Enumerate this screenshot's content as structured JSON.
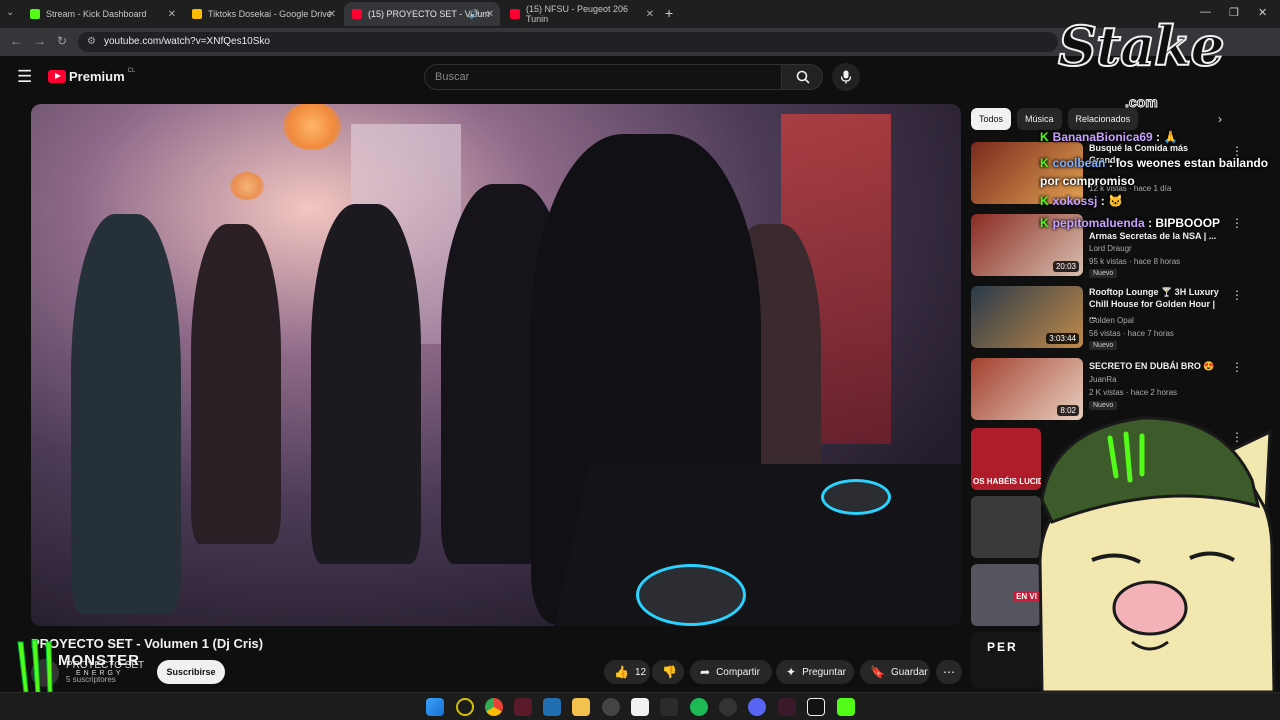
{
  "browser": {
    "tabs": [
      {
        "label": "Stream - Kick Dashboard",
        "favicon_color": "#53fc18"
      },
      {
        "label": "Tiktoks Dosekai - Google Drive",
        "favicon_color": "#fbbc04"
      },
      {
        "label": "(15) PROYECTO SET - Volum",
        "favicon_color": "#ff0033"
      },
      {
        "label": "(15) NFSU - Peugeot 206 Tunin",
        "favicon_color": "#ff0033"
      }
    ],
    "url": "youtube.com/watch?v=XNfQes10Sko"
  },
  "youtube": {
    "logo_text": "Premium",
    "logo_region": "CL",
    "search_placeholder": "Buscar",
    "video": {
      "title": "PROYECTO SET - Volumen 1 (Dj Cris)",
      "channel": "PROYECTO SET",
      "subscribers": "5 suscriptores",
      "subscribe_label": "Suscribirse",
      "likes": "12",
      "share_label": "Compartir",
      "ask_label": "Preguntar",
      "save_label": "Guardar"
    },
    "chips": [
      "Todos",
      "Música",
      "Relacionados"
    ],
    "recommendations": [
      {
        "title": "Busqué la Comida más Grande",
        "channel": "",
        "meta": "12 k vistas · hace 1 día",
        "duration": "",
        "badge": "",
        "thumb_color": "#7a2a1e"
      },
      {
        "title": "Armas Secretas de la NSA | ...",
        "channel": "Lord Draugr",
        "meta": "95 k vistas · hace 8 horas",
        "duration": "20:03",
        "badge": "Nuevo",
        "thumb_color": "#8a2b22"
      },
      {
        "title": "Rooftop Lounge 🍸 3H Luxury Chill House for Golden Hour | ...",
        "channel": "Golden Opal",
        "meta": "56 vistas · hace 7 horas",
        "duration": "3:03:44",
        "badge": "Nuevo",
        "thumb_color": "#6b4a2a"
      },
      {
        "title": "SECRETO EN DUBÁI BRO 😍",
        "channel": "JuanRa",
        "meta": "2 K vistas · hace 2 horas",
        "duration": "8:02",
        "badge": "Nuevo",
        "thumb_color": "#a3402e"
      }
    ],
    "side_thumbs": [
      {
        "text": "OS HABÉIS LUCIDO",
        "color": "#b01d2a"
      },
      {
        "text": "",
        "color": "#3a3a3a"
      },
      {
        "text": "EN VI",
        "color": "#555560"
      },
      {
        "text": "PER",
        "color": "#151515"
      }
    ]
  },
  "chat": [
    {
      "user": "BananaBionica69",
      "message": "🙏"
    },
    {
      "user": "coolbean",
      "message": "los weones estan bailando por compromiso"
    },
    {
      "user": "xokossj",
      "message": "🐱"
    },
    {
      "user": "pepitomaluenda",
      "message": "BIPBOOOP"
    }
  ],
  "overlay": {
    "stake_text": "Stake",
    "stake_com": ".com",
    "monster_text": "MONSTER",
    "monster_sub": "ENERGY"
  },
  "colors": {
    "kick_green": "#53fc18",
    "yt_red": "#ff0033",
    "bg": "#0f0f0f"
  }
}
